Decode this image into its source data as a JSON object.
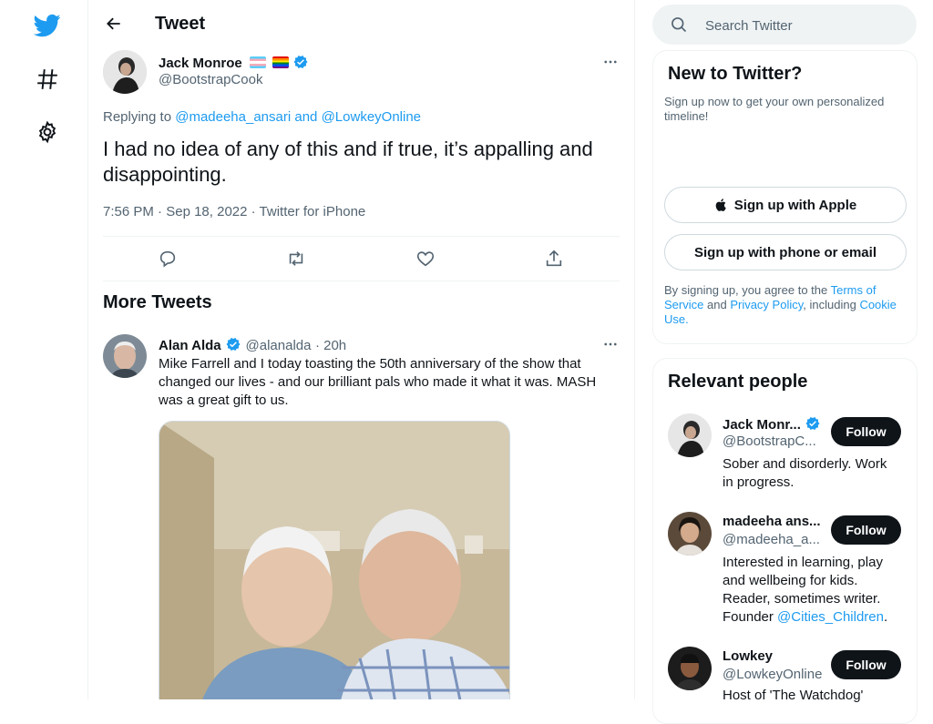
{
  "nav": {
    "icons": [
      "twitter-logo-icon",
      "hashtag-icon",
      "settings-icon"
    ]
  },
  "header": {
    "title": "Tweet"
  },
  "tweet": {
    "author_name": "Jack Monroe",
    "author_handle": "@BootstrapCook",
    "replying_prefix": "Replying to",
    "replying_user1": "@madeeha_ansari",
    "replying_and": "and",
    "replying_user2": "@LowkeyOnline",
    "text": "I had no idea of any of this and if true, it’s appalling and disappointing.",
    "time": "7:56 PM",
    "date": "Sep 18, 2022",
    "source": "Twitter for iPhone"
  },
  "more_tweets": {
    "title": "More Tweets",
    "item": {
      "author_name": "Alan Alda",
      "author_handle": "@alanalda",
      "age": "20h",
      "text": "Mike Farrell and I today toasting the 50th anniversary of the show that changed our lives - and our brilliant pals who made it what it was. MASH was a great gift to us."
    }
  },
  "search": {
    "placeholder": "Search Twitter"
  },
  "signup": {
    "title": "New to Twitter?",
    "subtitle": "Sign up now to get your own personalized timeline!",
    "apple_label": "Sign up with Apple",
    "phone_label": "Sign up with phone or email",
    "legal_prefix": "By signing up, you agree to the",
    "terms": "Terms of Service",
    "and": "and",
    "privacy": "Privacy Policy",
    "including": ", including",
    "cookie": "Cookie Use."
  },
  "relevant": {
    "title": "Relevant people",
    "follow_label": "Follow",
    "people": [
      {
        "name": "Jack Monr...",
        "handle": "@BootstrapC...",
        "bio": "Sober and disorderly. Work in progress."
      },
      {
        "name": "madeeha ans...",
        "handle": "@madeeha_a...",
        "bio": "Interested in learning, play and wellbeing for kids. Reader, sometimes writer. Founder",
        "bio_link": "@Cities_Children",
        "bio_end": "."
      },
      {
        "name": "Lowkey",
        "handle": "@LowkeyOnline",
        "bio": "Host of 'The Watchdog'"
      }
    ]
  },
  "colors": {
    "accent": "#1d9bf0",
    "text": "#0f1419",
    "secondary": "#536471",
    "border": "#eff3f4"
  }
}
